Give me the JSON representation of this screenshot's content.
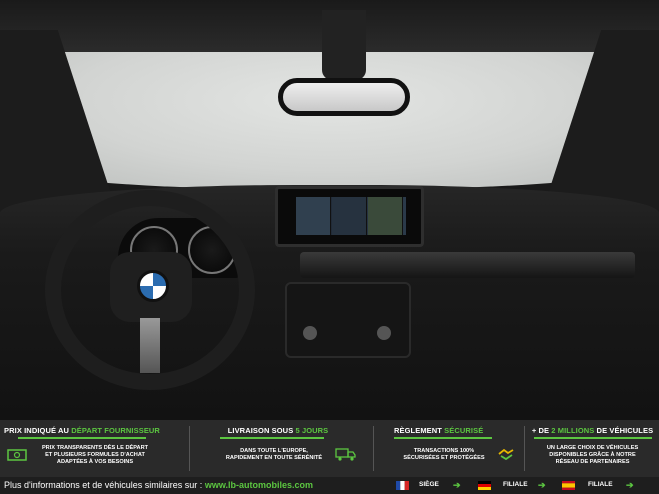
{
  "banner": {
    "col1": {
      "title_a": "PRIX INDIQUÉ AU ",
      "title_b": "DÉPART FOURNISSEUR",
      "line1": "PRIX TRANSPARENTS DÈS LE DÉPART",
      "line2": "ET PLUSIEURS FORMULES D'ACHAT",
      "line3": "ADAPTÉES À VOS BESOINS",
      "icon": "cash-icon"
    },
    "col2": {
      "title_a": "LIVRAISON SOUS ",
      "title_b": "5 JOURS",
      "line1": "DANS TOUTE L'EUROPE,",
      "line2": "RAPIDEMENT EN TOUTE SÉRÉNITÉ",
      "icon": "truck-icon"
    },
    "col3": {
      "title_a": "RÈGLEMENT ",
      "title_b": "SÉCURISÉ",
      "line1": "TRANSACTIONS 100%",
      "line2": "SÉCURISÉES ET PROTÉGÉES",
      "icon": "handshake-icon"
    },
    "col4": {
      "title_a": "+ DE ",
      "title_b": "2 MILLIONS",
      "title_c": " DE VÉHICULES",
      "line1": "UN LARGE CHOIX DE VÉHICULES",
      "line2": "DISPONIBLES GRÂCE À NOTRE",
      "line3": "RÉSEAU DE PARTENAIRES"
    }
  },
  "footer": {
    "info": "Plus d'informations et de véhicules similaires sur : ",
    "url": "www.lb-automobiles.com",
    "siege": "SIÈGE",
    "filiale1": "FILIALE",
    "filiale2": "FILIALE"
  },
  "colors": {
    "accent": "#5cc641",
    "banner_bg": "#2a2a2a"
  }
}
